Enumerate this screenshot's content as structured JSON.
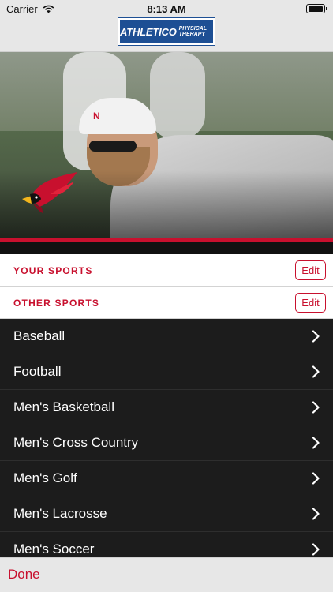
{
  "status_bar": {
    "carrier": "Carrier",
    "time": "8:13 AM"
  },
  "header": {
    "logo_word1": "ATHLETICO",
    "logo_word2": "PHYSICAL THERAPY"
  },
  "sections": {
    "your_sports": {
      "label": "YOUR SPORTS",
      "edit_label": "Edit"
    },
    "other_sports": {
      "label": "OTHER SPORTS",
      "edit_label": "Edit"
    }
  },
  "sports": [
    "Baseball",
    "Football",
    "Men's Basketball",
    "Men's Cross Country",
    "Men's Golf",
    "Men's Lacrosse",
    "Men's Soccer"
  ],
  "toolbar": {
    "done_label": "Done"
  },
  "colors": {
    "accent": "#c8102e",
    "list_bg": "#1c1c1c",
    "bar_bg": "#e7e7e7",
    "logo_blue": "#1d4f94"
  }
}
